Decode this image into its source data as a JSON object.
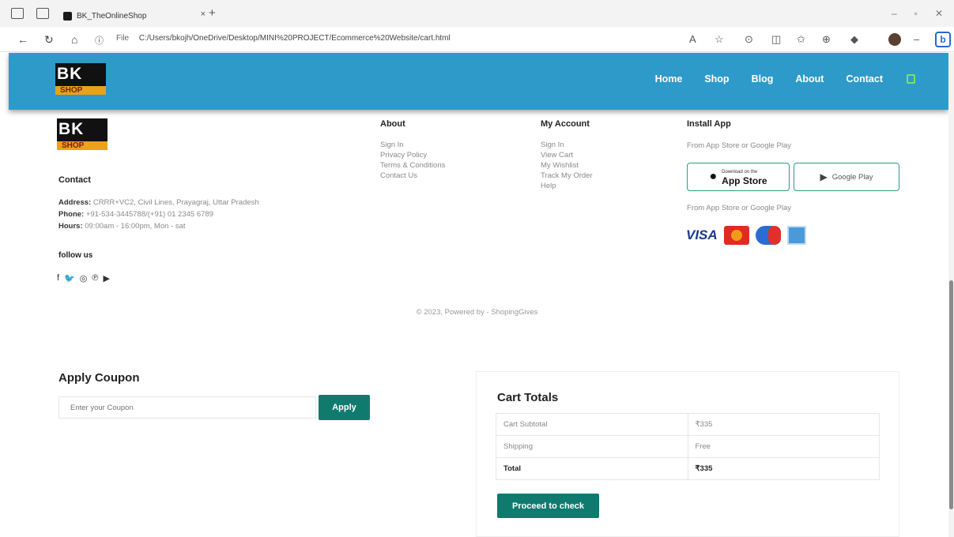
{
  "browser": {
    "tab_title": "BK_TheOnlineShop",
    "tab_close": "×",
    "new_tab": "+",
    "url_prefix": "File",
    "url": "C:/Users/bkojh/OneDrive/Desktop/MINI%20PROJECT/Ecommerce%20Website/cart.html"
  },
  "brand": {
    "line1": "BK",
    "line2": "SHOP"
  },
  "nav": [
    "Home",
    "Shop",
    "Blog",
    "About",
    "Contact"
  ],
  "footer": {
    "contact_heading": "Contact",
    "address_label": "Address:",
    "address": "CRRR+VC2, Civil Lines, Prayagraj, Uttar Pradesh",
    "phone_label": "Phone:",
    "phone": "+91-534-3445788/(+91) 01 2345 6789",
    "hours_label": "Hours:",
    "hours": "09:00am - 16:00pm, Mon - sat",
    "follow_label": "follow us",
    "about_heading": "About",
    "about_links": [
      "Sign In",
      "Privacy Policy",
      "Terms & Conditions",
      "Contact Us"
    ],
    "account_heading": "My Account",
    "account_links": [
      "Sign In",
      "View Cart",
      "My Wishlist",
      "Track My Order",
      "Help"
    ],
    "install_heading": "Install App",
    "install_note": "From App Store or Google Play",
    "appstore_small": "Download on the",
    "appstore_big": "App Store",
    "googleplay": "Google Play",
    "payment_note": "From App Store or Google Play",
    "visa": "VISA",
    "copyright": "© 2023, Powered by - ShopingGives"
  },
  "coupon": {
    "title": "Apply Coupon",
    "placeholder": "Enter your Coupon",
    "button": "Apply"
  },
  "cart_totals": {
    "title": "Cart Totals",
    "rows": [
      {
        "label": "Cart Subtotal",
        "value": "₹335"
      },
      {
        "label": "Shipping",
        "value": "Free"
      },
      {
        "label": "Total",
        "value": "₹335"
      }
    ],
    "checkout_button": "Proceed to check"
  }
}
